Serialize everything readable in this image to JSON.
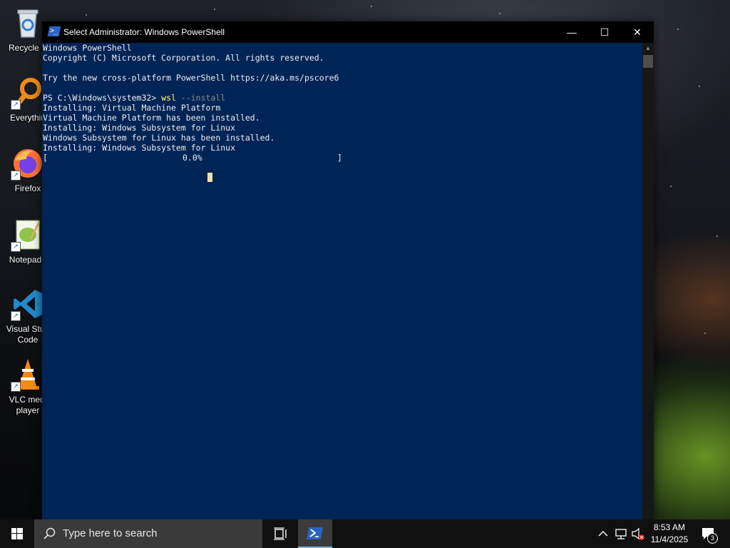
{
  "desktop": {
    "icons": [
      {
        "label": "Recycle B",
        "name": "recycle-bin"
      },
      {
        "label": "Everythin",
        "name": "everything"
      },
      {
        "label": "Firefox",
        "name": "firefox"
      },
      {
        "label": "Notepad+",
        "name": "notepad-plus-plus"
      },
      {
        "label": "Visual Stud\nCode",
        "name": "visual-studio-code"
      },
      {
        "label": "VLC medi\nplayer",
        "name": "vlc-media-player"
      }
    ]
  },
  "window": {
    "title": "Select Administrator: Windows PowerShell",
    "controls": {
      "minimize": "—",
      "maximize": "☐",
      "close": "✕"
    }
  },
  "console": {
    "lines": [
      "Windows PowerShell",
      "Copyright (C) Microsoft Corporation. All rights reserved.",
      "",
      "Try the new cross-platform PowerShell https://aka.ms/pscore6",
      "",
      "",
      "Installing: Virtual Machine Platform",
      "Virtual Machine Platform has been installed.",
      "Installing: Windows Subsystem for Linux",
      "Windows Subsystem for Linux has been installed.",
      "Installing: Windows Subsystem for Linux"
    ],
    "prompt": "PS C:\\Windows\\system32>",
    "command": "wsl",
    "parameter": "--install",
    "progress": {
      "open": "[",
      "percent_text": "0.0%",
      "close": "]",
      "fraction": 0.0
    }
  },
  "taskbar": {
    "search_placeholder": "Type here to search",
    "clock_time": "8:53 AM",
    "clock_date": "11/4/2025",
    "notification_count": "3"
  }
}
